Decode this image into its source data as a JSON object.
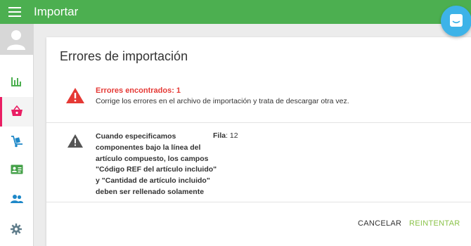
{
  "appbar": {
    "title": "Importar"
  },
  "icons": {
    "menu": "menu-icon",
    "chat": "chat-icon",
    "avatar": "user-avatar-icon",
    "sidebar": [
      "bar-chart-icon",
      "basket-icon",
      "hand-truck-icon",
      "id-card-icon",
      "people-icon",
      "gear-icon"
    ]
  },
  "colors": {
    "appbar": "#4caf50",
    "active_indicator": "#e91e63",
    "error": "#e53935",
    "retry": "#8bc34a",
    "chat_button": "#3db3e8"
  },
  "dialog": {
    "title": "Errores de importación",
    "summary_title": "Errores encontrados: 1",
    "summary_text": "Corrige los errores en el archivo de importación y trata de descargar otra vez.",
    "errors": [
      {
        "message": "Cuando especificamos componentes bajo la línea del artículo compuesto, los campos \"Código REF del artículo incluido\" y \"Cantidad de artículo incluido\" deben ser rellenado solamente",
        "row_label": "Fila",
        "row_value": ": 12"
      }
    ],
    "cancel_label": "CANCELAR",
    "retry_label": "REINTENTAR"
  }
}
